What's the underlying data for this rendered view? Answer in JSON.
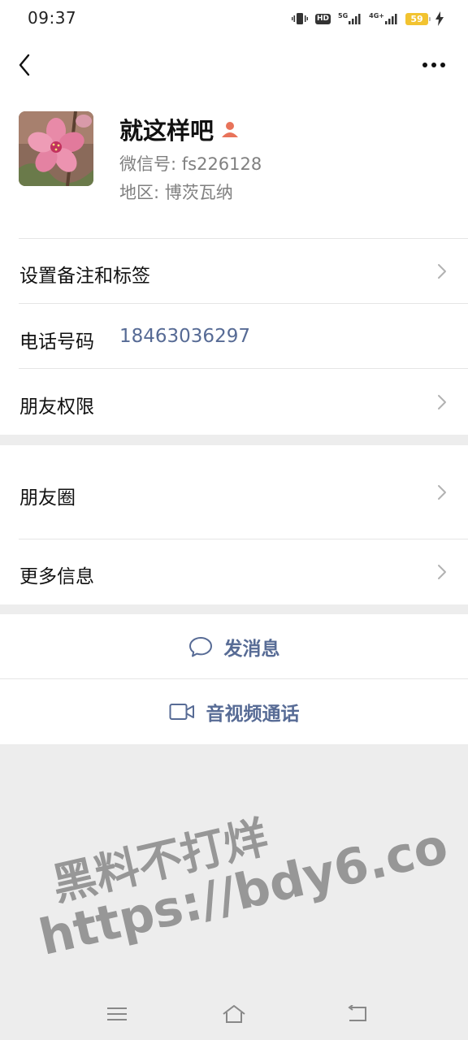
{
  "status_bar": {
    "time": "09:37",
    "hd_label": "HD",
    "net1_label": "5G",
    "net2_label": "4G+",
    "battery_level": "59"
  },
  "nav": {
    "back_icon": "chevron-left-icon",
    "more_icon": "more-dots-icon"
  },
  "profile": {
    "name": "就这样吧",
    "wechat_id": "微信号: fs226128",
    "region": "地区: 博茨瓦纳"
  },
  "rows": {
    "remark": "设置备注和标签",
    "phone_label": "电话号码",
    "phone_value": "18463036297",
    "permissions": "朋友权限",
    "moments": "朋友圈",
    "more_info": "更多信息"
  },
  "actions": {
    "message": "发消息",
    "video_call": "音视频通话"
  },
  "watermark": {
    "line1": "黑料不打烊",
    "line2": "https://bdy6.co"
  },
  "colors": {
    "link_blue": "#576b95",
    "background": "#ededed",
    "person_icon": "#e8735a",
    "battery": "#f2c330"
  }
}
